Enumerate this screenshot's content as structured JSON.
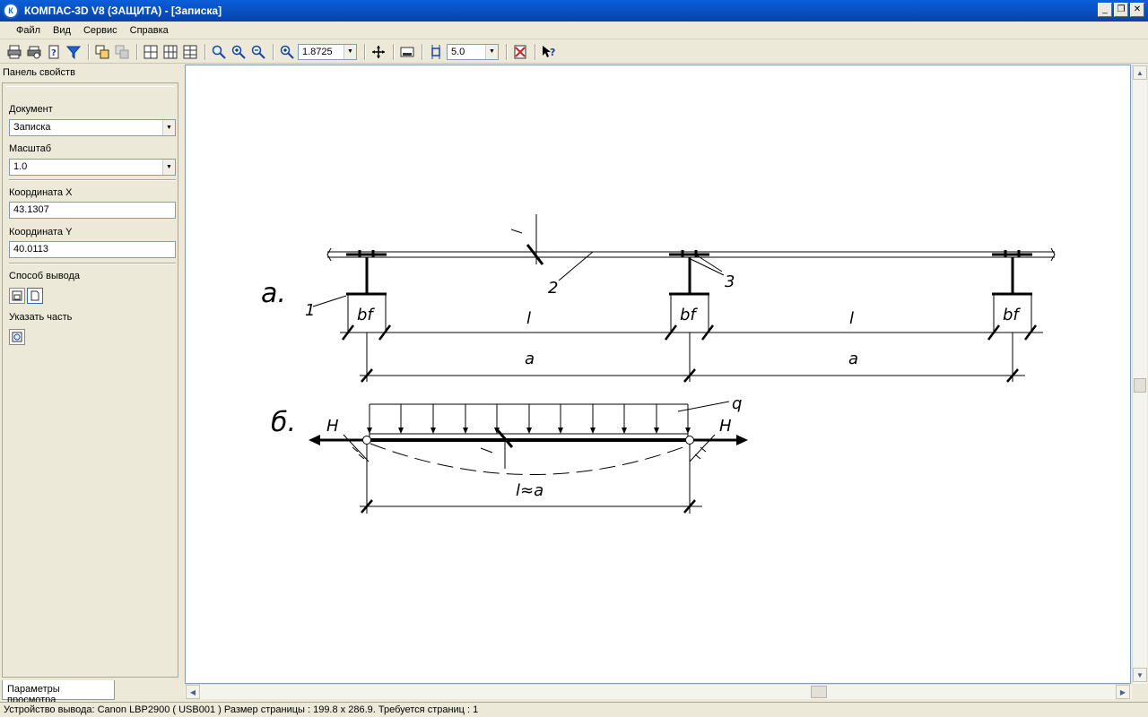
{
  "window": {
    "title": "КОМПАС-3D V8 (ЗАЩИТА) - [Записка]",
    "app_icon": "К"
  },
  "menu": [
    "Файл",
    "Вид",
    "Сервис",
    "Справка"
  ],
  "toolbar": {
    "zoom_value": "1.8725",
    "step_value": "5.0"
  },
  "panel": {
    "header": "Панель свойств",
    "document_label": "Документ",
    "document_value": "Записка",
    "scale_label": "Масштаб",
    "scale_value": "1.0",
    "coord_x_label": "Координата X",
    "coord_x_value": "43.1307",
    "coord_y_label": "Координата Y",
    "coord_y_value": "40.0113",
    "output_mode_label": "Способ вывода",
    "select_part_label": "Указать часть",
    "tab_label": "Параметры просмотра"
  },
  "drawing": {
    "label_a": "а.",
    "label_b": "б.",
    "n1": "1",
    "n2": "2",
    "n3": "3",
    "bf": "bf",
    "span_l": "l",
    "span_a": "a",
    "q": "q",
    "h": "H",
    "l_approx_a": "l≈a"
  },
  "status": "Устройство вывода: Canon LBP2900 ( USB001 )  Размер страницы : 199.8 x 286.9.  Требуется страниц : 1"
}
